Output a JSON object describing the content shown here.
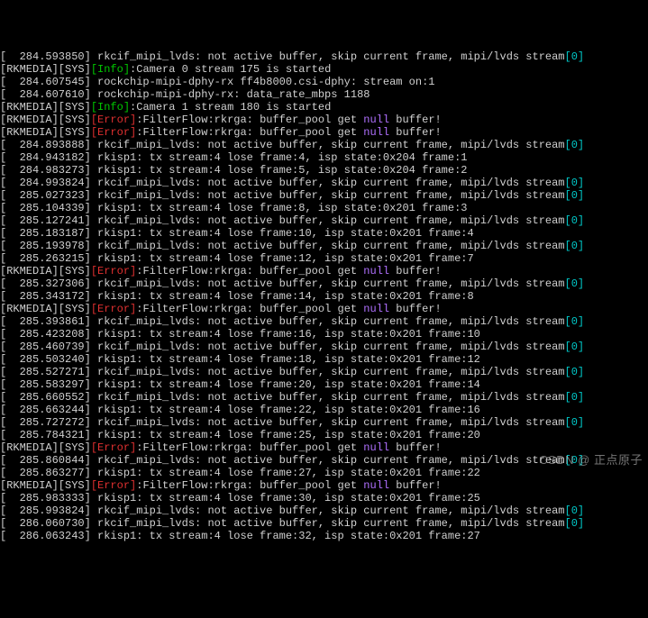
{
  "prefix": "[RKMEDIA][SYS]",
  "info_tag": "[Info]",
  "error_tag": "[Error]",
  "filterflow": ":FilterFlow:rkrga: buffer_pool get ",
  "null_word": "null",
  "buffer_tail": " buffer!",
  "skip_msg": " rkcif_mipi_lvds: not active buffer, skip current frame, mipi/lvds stream",
  "stream_idx": "[0]",
  "lines": [
    {
      "t": "kern_skip",
      "ts": "[  284.593850]"
    },
    {
      "t": "info",
      "msg": ":Camera 0 stream 175 is started"
    },
    {
      "t": "kern",
      "ts": "[  284.607545]",
      "msg": " rockchip-mipi-dphy-rx ff4b8000.csi-dphy: stream on:1"
    },
    {
      "t": "kern",
      "ts": "[  284.607610]",
      "msg": " rockchip-mipi-dphy-rx: data_rate_mbps 1188"
    },
    {
      "t": "info",
      "msg": ":Camera 1 stream 180 is started"
    },
    {
      "t": "error"
    },
    {
      "t": "error"
    },
    {
      "t": "kern_skip",
      "ts": "[  284.893888]"
    },
    {
      "t": "kern",
      "ts": "[  284.943182]",
      "msg": " rkisp1: tx stream:4 lose frame:4, isp state:0x204 frame:1"
    },
    {
      "t": "kern",
      "ts": "[  284.983273]",
      "msg": " rkisp1: tx stream:4 lose frame:5, isp state:0x204 frame:2"
    },
    {
      "t": "kern_skip",
      "ts": "[  284.993824]"
    },
    {
      "t": "kern_skip",
      "ts": "[  285.027323]"
    },
    {
      "t": "kern",
      "ts": "[  285.104339]",
      "msg": " rkisp1: tx stream:4 lose frame:8, isp state:0x201 frame:3"
    },
    {
      "t": "kern_skip",
      "ts": "[  285.127241]"
    },
    {
      "t": "kern",
      "ts": "[  285.183187]",
      "msg": " rkisp1: tx stream:4 lose frame:10, isp state:0x201 frame:4"
    },
    {
      "t": "kern_skip",
      "ts": "[  285.193978]"
    },
    {
      "t": "kern",
      "ts": "[  285.263215]",
      "msg": " rkisp1: tx stream:4 lose frame:12, isp state:0x201 frame:7"
    },
    {
      "t": "error"
    },
    {
      "t": "kern_skip",
      "ts": "[  285.327306]"
    },
    {
      "t": "kern",
      "ts": "[  285.343172]",
      "msg": " rkisp1: tx stream:4 lose frame:14, isp state:0x201 frame:8"
    },
    {
      "t": "error"
    },
    {
      "t": "kern_skip",
      "ts": "[  285.393861]"
    },
    {
      "t": "kern",
      "ts": "[  285.423208]",
      "msg": " rkisp1: tx stream:4 lose frame:16, isp state:0x201 frame:10"
    },
    {
      "t": "kern_skip",
      "ts": "[  285.460739]"
    },
    {
      "t": "kern",
      "ts": "[  285.503240]",
      "msg": " rkisp1: tx stream:4 lose frame:18, isp state:0x201 frame:12"
    },
    {
      "t": "kern_skip",
      "ts": "[  285.527271]"
    },
    {
      "t": "kern",
      "ts": "[  285.583297]",
      "msg": " rkisp1: tx stream:4 lose frame:20, isp state:0x201 frame:14"
    },
    {
      "t": "kern_skip",
      "ts": "[  285.660552]"
    },
    {
      "t": "kern",
      "ts": "[  285.663244]",
      "msg": " rkisp1: tx stream:4 lose frame:22, isp state:0x201 frame:16"
    },
    {
      "t": "kern_skip",
      "ts": "[  285.727272]"
    },
    {
      "t": "kern",
      "ts": "[  285.784321]",
      "msg": " rkisp1: tx stream:4 lose frame:25, isp state:0x201 frame:20"
    },
    {
      "t": "error"
    },
    {
      "t": "kern_skip",
      "ts": "[  285.860844]"
    },
    {
      "t": "kern",
      "ts": "[  285.863277]",
      "msg": " rkisp1: tx stream:4 lose frame:27, isp state:0x201 frame:22"
    },
    {
      "t": "error"
    },
    {
      "t": "kern",
      "ts": "[  285.983333]",
      "msg": " rkisp1: tx stream:4 lose frame:30, isp state:0x201 frame:25"
    },
    {
      "t": "kern_skip",
      "ts": "[  285.993824]"
    },
    {
      "t": "kern_skip",
      "ts": "[  286.060730]"
    },
    {
      "t": "kern",
      "ts": "[  286.063243]",
      "msg": " rkisp1: tx stream:4 lose frame:32, isp state:0x201 frame:27"
    }
  ],
  "watermark": "CSDN @ 正点原子"
}
